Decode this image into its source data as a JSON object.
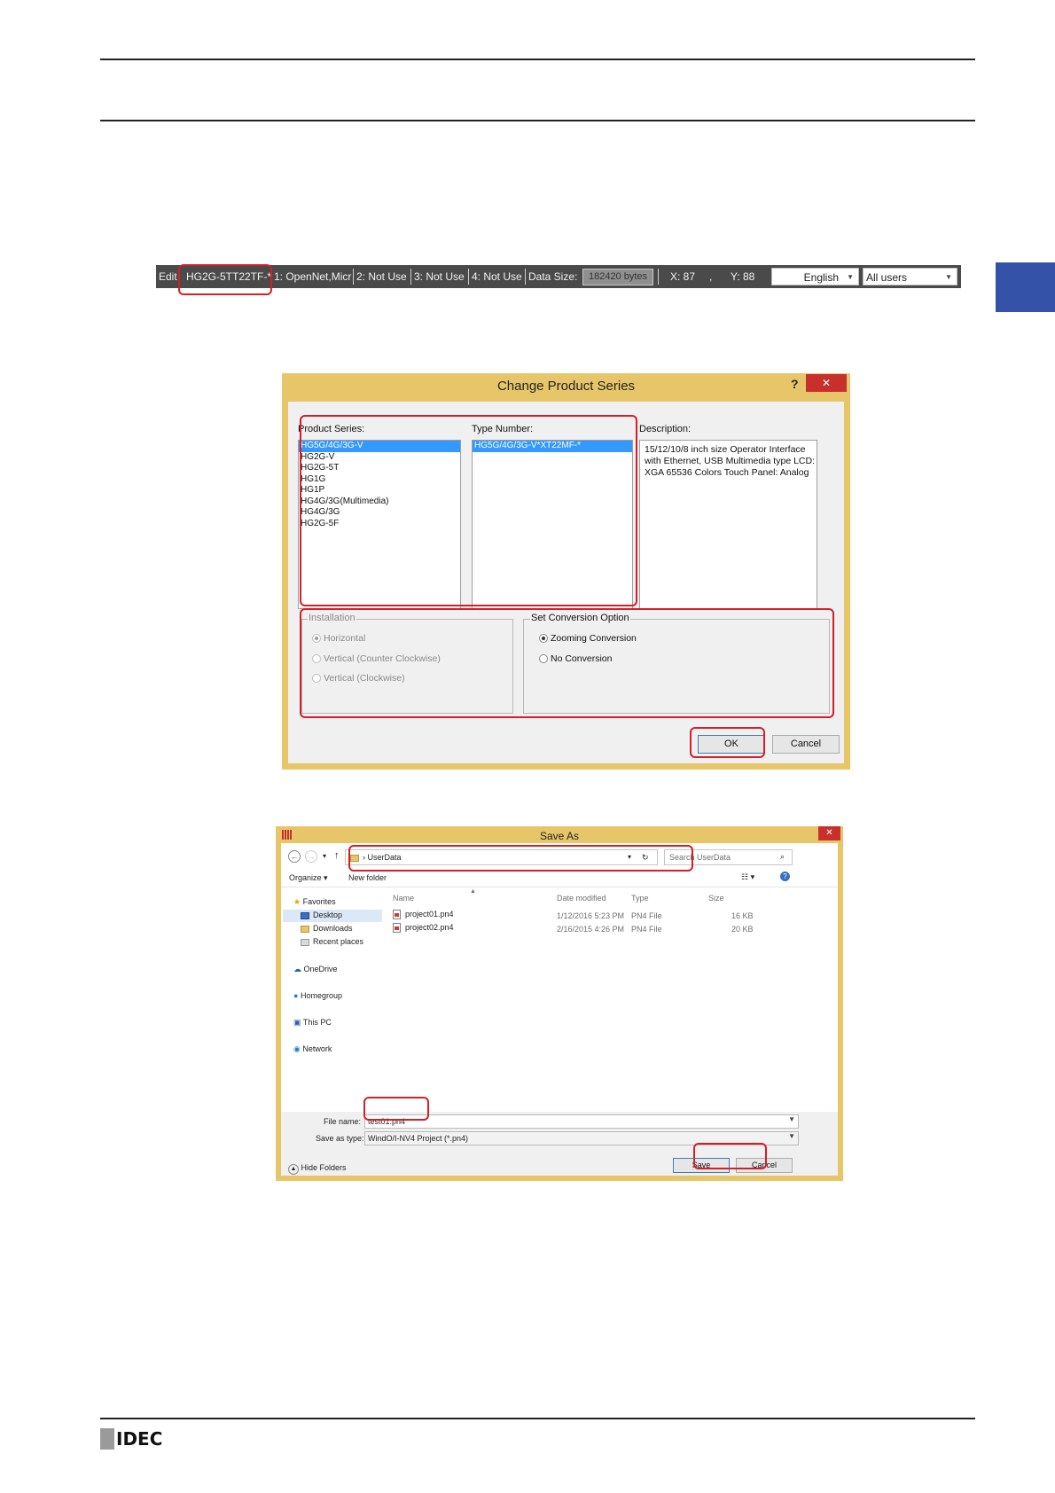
{
  "status_bar": {
    "edit_label": "Edit",
    "model": "HG2G-5TT22TF-*",
    "port1": "1: OpenNet,Micr",
    "port2": "2: Not Use",
    "port3": "3: Not Use",
    "port4": "4: Not Use",
    "data_size_label": "Data Size:",
    "data_size_value": "182420 bytes",
    "x_coord": "X: 87",
    "comma": ",",
    "y_coord": "Y: 88",
    "language": "English",
    "user": "All users"
  },
  "change_product_series": {
    "title": "Change Product Series",
    "help_glyph": "?",
    "close_glyph": "✕",
    "product_series_label": "Product Series:",
    "product_series": [
      "HG5G/4G/3G-V",
      "HG2G-V",
      "HG2G-5T",
      "HG1G",
      "HG1P",
      "HG4G/3G(Multimedia)",
      "HG4G/3G",
      "HG2G-5F"
    ],
    "type_number_label": "Type Number:",
    "type_numbers": [
      "HG5G/4G/3G-V*XT22MF-*"
    ],
    "description_label": "Description:",
    "description_lines": [
      "15/12/10/8 inch size Operator Interface",
      "with Ethernet, USB Multimedia type LCD:",
      "XGA 65536 Colors Touch Panel: Analog"
    ],
    "installation": {
      "title": "Installation",
      "options": [
        "Horizontal",
        "Vertical (Counter Clockwise)",
        "Vertical (Clockwise)"
      ]
    },
    "conversion": {
      "title": "Set Conversion Option",
      "options": [
        "Zooming Conversion",
        "No Conversion"
      ]
    },
    "ok_label": "OK",
    "cancel_label": "Cancel"
  },
  "save_as": {
    "title": "Save As",
    "close_glyph": "✕",
    "breadcrumb_arrow": "›",
    "path": "UserData",
    "search_placeholder": "Search UserData",
    "organize_label": "Organize ▾",
    "new_folder_label": "New folder",
    "nav": {
      "favorites": "Favorites",
      "desktop": "Desktop",
      "downloads": "Downloads",
      "recent_places": "Recent places",
      "onedrive": "OneDrive",
      "homegroup": "Homegroup",
      "this_pc": "This PC",
      "network": "Network"
    },
    "columns": [
      "Name",
      "Date modified",
      "Type",
      "Size"
    ],
    "files": [
      {
        "name": "project01.pn4",
        "date": "1/12/2016 5:23 PM",
        "type": "PN4 File",
        "size": "16 KB"
      },
      {
        "name": "project02.pn4",
        "date": "2/16/2015 4:26 PM",
        "type": "PN4 File",
        "size": "20 KB"
      }
    ],
    "file_name_label": "File name:",
    "file_name_value": "test01.pn4",
    "save_type_label": "Save as type:",
    "save_type_value": "WindO/I-NV4 Project (*.pn4)",
    "hide_folders_label": "Hide Folders",
    "save_label": "Save",
    "cancel_label": "Cancel"
  },
  "footer": {
    "logo_text": "IDEC"
  }
}
